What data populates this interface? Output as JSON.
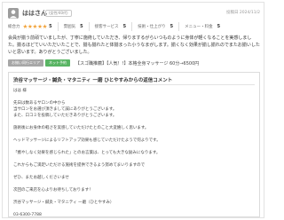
{
  "review": {
    "name": "ははさん",
    "age": "(女性/40代)",
    "date": "投稿日 2024/11/2",
    "ratings": [
      {
        "label": "総合力",
        "stars": "★★★★★",
        "value": "5"
      },
      {
        "label": "雰囲気",
        "stars": "★★★★★",
        "value": "5"
      },
      {
        "label": "接客サービス",
        "stars": "★★★★★",
        "value": "5"
      },
      {
        "label": "技術・仕上がり",
        "stars": "★★★★★",
        "value": "5"
      },
      {
        "label": "メニュー・料金",
        "stars": "★★★★★",
        "value": "5"
      }
    ],
    "body": "会員が揃う前頑ていましたが、丁寧に施術していただき、帰りまするがらいつものように身体が軽くなることを実感しました。揃るほどていいただいたことで、揃も揃れたと体揃まった小うなまがします。揃くなく効果が揃し揃れのでまたお揃いしたいと思います。ありがとうございました。",
    "tags": [
      "お揃い同行エリア",
      "ネット予約"
    ],
    "meta": "【スゴ職推薦】【人気！!】本格全身マッサージ 60分→6500円"
  },
  "reply": {
    "title": "渋谷マッサージ・鍼灸・マタニティ 一磨 ひとやすみからの返信コメント",
    "lines": [
      "はは 様",
      "",
      "先日は数あるサロンの中から",
      "当サロンをお選び頂きまして誠にありがとうございます。",
      "また、口コミを投稿していただきありがとうございます。",
      "",
      "施術後にお身体の軽さを実感していただけたとのこと大変嬉しく思います。",
      "",
      "ヘッドマッサージによるリフトアップ効果も感じていただけたようで何よりです。",
      "",
      "「癒やしなく効果を感じられた」とのお言葉は、とっても大きな励みになります。",
      "",
      "これからもご満足いただける施術を提供できるよう努めてまいりますので",
      "",
      "ぜひ、またお越しくださいませ",
      "",
      "次回のご来店を心よりお待ちしております！",
      "",
      "渋谷マッサージ・鍼灸・マタニティ 一磨（ひとやすみ）",
      "",
      "03-6300-7788"
    ]
  },
  "colors": {
    "accent_star": "#f2a33a",
    "tag_green": "#58b463",
    "tag_gray": "#a7a7a7"
  }
}
